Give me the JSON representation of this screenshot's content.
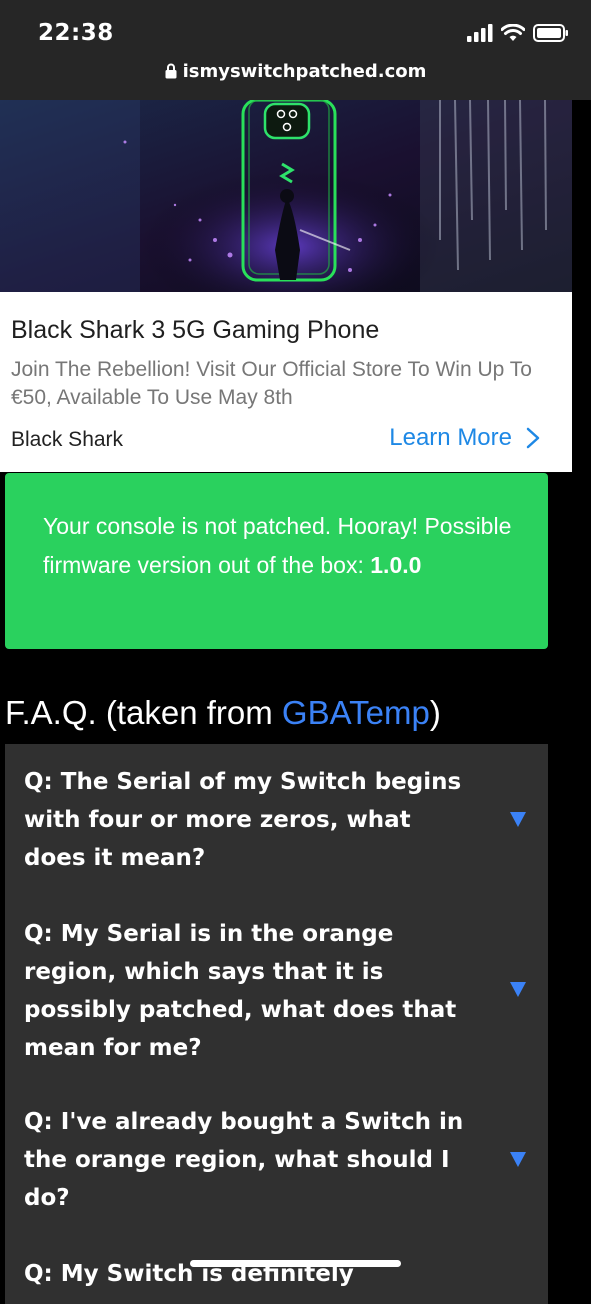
{
  "status_bar": {
    "time": "22:38",
    "signal_icon": "cellular-signal-icon",
    "wifi_icon": "wifi-icon",
    "battery_icon": "battery-icon"
  },
  "browser": {
    "url": "ismyswitchpatched.com",
    "lock_icon": "lock-icon"
  },
  "ad": {
    "title": "Black Shark 3 5G Gaming Phone",
    "description": "Join The Rebellion! Visit Our Official Store To Win Up To €50, Available To Use May 8th",
    "brand": "Black Shark",
    "cta_label": "Learn More",
    "cta_icon": "chevron-right-icon",
    "accent_color": "#1e88e5"
  },
  "result": {
    "message": "Your console is not patched. Hooray! Possible firmware version out of the box: ",
    "firmware": "1.0.0",
    "background_color": "#2ad15e"
  },
  "faq": {
    "heading_prefix": "F.A.Q. (taken from ",
    "heading_link": "GBATemp",
    "heading_suffix": ")",
    "link_color": "#3b82f6",
    "items": [
      {
        "question": "Q: The Serial of my Switch begins with four or more zeros, what does it mean?"
      },
      {
        "question": "Q: My Serial is in the orange region, which says that it is possibly patched, what does that mean for me?"
      },
      {
        "question": "Q: I've already bought a Switch in the orange region, what should I do?"
      },
      {
        "question": "Q: My Switch is definitely"
      }
    ],
    "toggle_icon": "triangle-down-icon"
  }
}
